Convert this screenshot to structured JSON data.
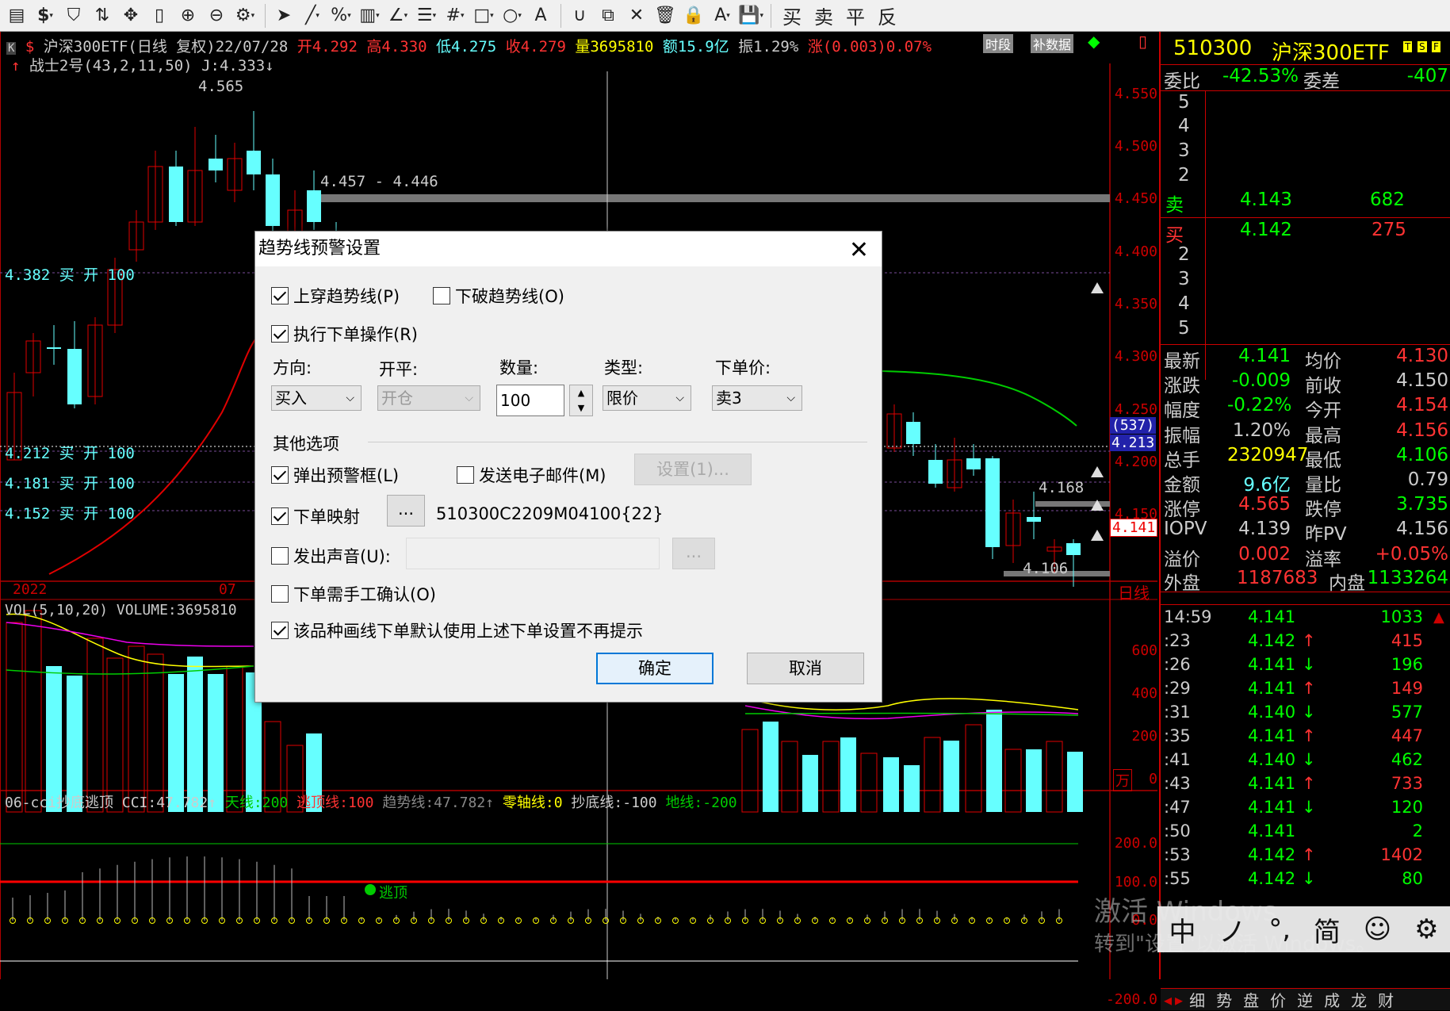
{
  "toolbar": {
    "items": [
      "file-icon",
      "dollar-icon",
      "filter-icon",
      "swap-icon",
      "move-icon",
      "ruler-icon",
      "zoom-in-icon",
      "zoom-out-icon",
      "gear-icon",
      "cursor-icon",
      "line-icon",
      "percent-icon",
      "bars-icon",
      "angle-icon",
      "list-icon",
      "grid-icon",
      "rect-icon",
      "circle-icon",
      "text-icon",
      "magnet-icon",
      "copy-icon",
      "cross-icon",
      "trash-icon",
      "lock-icon",
      "color-icon",
      "save-icon"
    ],
    "trade_buttons": [
      "买",
      "卖",
      "平",
      "反"
    ]
  },
  "chart": {
    "header": "沪深300ETF(日线 复权)22/07/28",
    "open": "开4.292",
    "high": "高4.330",
    "low": "低4.275",
    "close": "收4.279",
    "vol": "量3695810",
    "amount": "额15.9亿",
    "amp": "振1.29%",
    "chg": "涨(0.003)0.07%",
    "tag1": "时段",
    "tag2": "补数据",
    "indicator": "战士2号(43,2,11,50)",
    "j": "J:4.333",
    "hi_label": "4.565",
    "range_label": "4.457 - 4.446",
    "orders": [
      "4.382 买 开 100",
      "4.212 买 开 100",
      "4.181 买 开 100",
      "4.152 买 开 100"
    ],
    "low_label": "4.106",
    "mid_label": "4.168",
    "y_ticks": [
      "4.550",
      "4.500",
      "4.450",
      "4.400",
      "4.350",
      "4.300",
      "4.250",
      "4.200",
      "4.150"
    ],
    "price_box": "4.213",
    "price_box2": "(537)",
    "cur_price": "4.141",
    "x_labels": [
      "2022",
      "07"
    ],
    "period": "日线",
    "vol_header": "VOL(5,10,20) VOLUME:3695810",
    "vol_ticks": [
      "600",
      "400",
      "200",
      "0"
    ],
    "vol_unit": "万",
    "cci_header": "06-cci抄底逃顶 CCI:47.782",
    "cci_parts": [
      "天线:200",
      "逃顶线:100",
      "趋势线:47.782",
      "零轴线:0",
      "抄底线:-100",
      "地线:-200"
    ],
    "cci_ticks": [
      "200.0",
      "100.0",
      "0.0",
      "-200.0"
    ],
    "escape_label": "逃顶"
  },
  "dialog": {
    "title": "趋势线预警设置",
    "cb_up": "上穿趋势线(P)",
    "cb_down": "下破趋势线(O)",
    "cb_exec": "执行下单操作(R)",
    "lbl_dir": "方向:",
    "lbl_oc": "开平:",
    "lbl_qty": "数量:",
    "lbl_type": "类型:",
    "lbl_price": "下单价:",
    "dir": "买入",
    "oc": "开仓",
    "qty": "100",
    "type": "限价",
    "price": "卖3",
    "other": "其他选项",
    "cb_popup": "弹出预警框(L)",
    "cb_email": "发送电子邮件(M)",
    "btn_set": "设置(1)...",
    "cb_map": "下单映射",
    "btn_dots": "...",
    "map_code": "510300C2209M04100{22}",
    "cb_sound": "发出声音(U):",
    "btn_dots2": "...",
    "cb_confirm": "下单需手工确认(O)",
    "cb_default": "该品种画线下单默认使用上述下单设置不再提示",
    "ok": "确定",
    "cancel": "取消"
  },
  "right": {
    "code": "510300",
    "name": "沪深300ETF",
    "wb": "委比",
    "wb_v": "-42.53%",
    "wc": "委差",
    "wc_v": "-407",
    "sell_levels": [
      "5",
      "4",
      "3",
      "2"
    ],
    "sell1": "卖",
    "sell1_p": "4.143",
    "sell1_v": "682",
    "buy1": "买",
    "buy1_p": "4.142",
    "buy1_v": "275",
    "buy_levels": [
      "2",
      "3",
      "4",
      "5"
    ],
    "stats": [
      [
        "最新",
        "4.141",
        "均价",
        "4.130"
      ],
      [
        "涨跌",
        "-0.009",
        "前收",
        "4.150"
      ],
      [
        "幅度",
        "-0.22%",
        "今开",
        "4.154"
      ],
      [
        "振幅",
        "1.20%",
        "最高",
        "4.156"
      ],
      [
        "总手",
        "2320947",
        "最低",
        "4.106"
      ],
      [
        "金额",
        "9.6亿",
        "量比",
        "0.79"
      ],
      [
        "涨停",
        "4.565",
        "跌停",
        "3.735"
      ],
      [
        "IOPV",
        "4.139",
        "昨PV",
        "4.156"
      ],
      [
        "溢价",
        "0.002",
        "溢率",
        "+0.05%"
      ]
    ],
    "outer": "外盘",
    "outer_v": "1187683",
    "inner": "内盘",
    "inner_v": "1133264",
    "ticks": [
      [
        "14:59",
        "4.141",
        "",
        "1033"
      ],
      [
        ":23",
        "4.142",
        "↑",
        "415"
      ],
      [
        ":26",
        "4.141",
        "↓",
        "196"
      ],
      [
        ":29",
        "4.141",
        "↑",
        "149"
      ],
      [
        ":31",
        "4.140",
        "↓",
        "577"
      ],
      [
        ":35",
        "4.141",
        "↑",
        "447"
      ],
      [
        ":41",
        "4.140",
        "↓",
        "462"
      ],
      [
        ":43",
        "4.141",
        "↑",
        "733"
      ],
      [
        ":47",
        "4.141",
        "↓",
        "120"
      ],
      [
        ":50",
        "4.141",
        "",
        "2"
      ],
      [
        ":53",
        "4.142",
        "↑",
        "1402"
      ],
      [
        ":55",
        "4.142",
        "↓",
        "80"
      ]
    ],
    "bottom_tabs": [
      "细",
      "势",
      "盘",
      "价",
      "逆",
      "成",
      "龙",
      "财"
    ],
    "ime": [
      "中",
      "ノ",
      "°,",
      "简",
      "☺",
      "⚙"
    ],
    "watermark1": "激活 Windows",
    "watermark2": "转到\"设置\"以激活 Windows。"
  }
}
